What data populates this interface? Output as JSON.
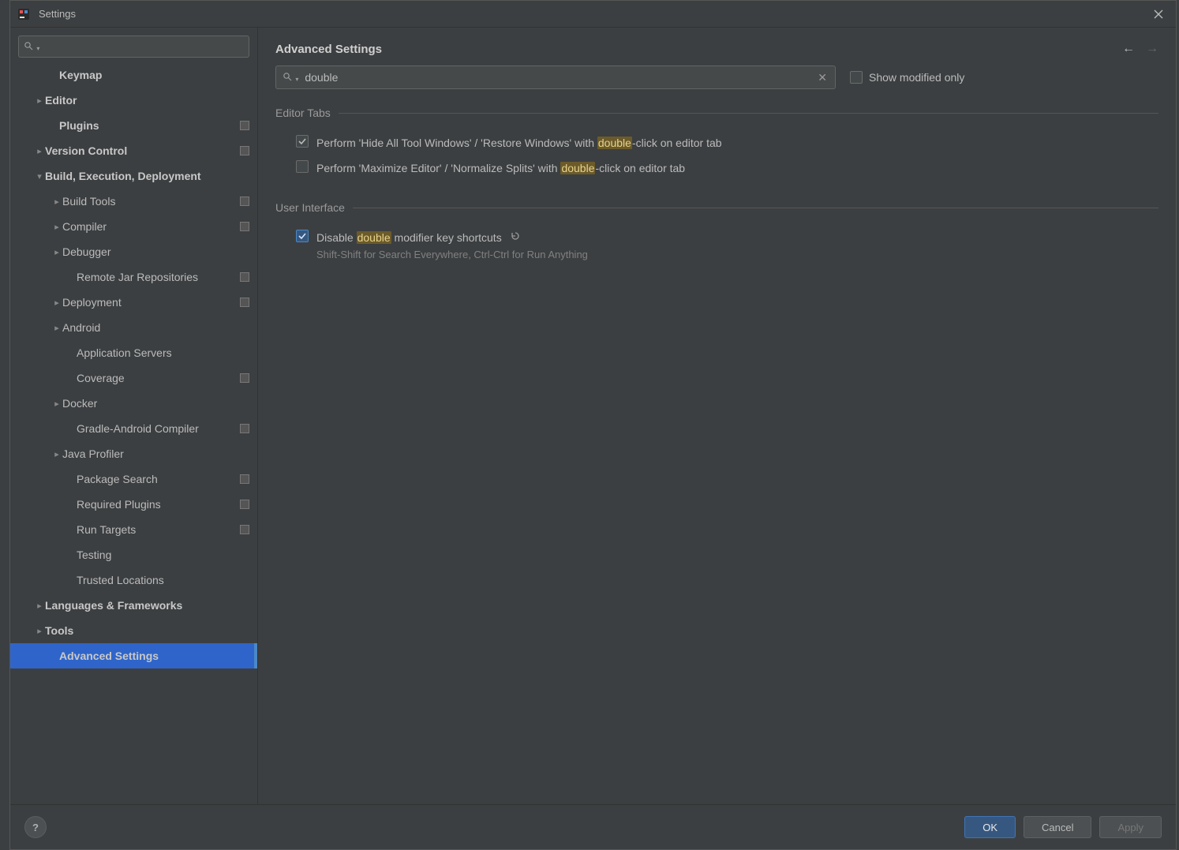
{
  "window": {
    "title": "Settings"
  },
  "sidebar": {
    "search_placeholder": "",
    "items": [
      {
        "label": "Keymap",
        "indent": 48,
        "bold": true,
        "chev": ""
      },
      {
        "label": "Editor",
        "indent": 30,
        "bold": true,
        "chev": "right"
      },
      {
        "label": "Plugins",
        "indent": 48,
        "bold": true,
        "chev": "",
        "marker": true
      },
      {
        "label": "Version Control",
        "indent": 30,
        "bold": true,
        "chev": "right",
        "marker": true
      },
      {
        "label": "Build, Execution, Deployment",
        "indent": 30,
        "bold": true,
        "chev": "down"
      },
      {
        "label": "Build Tools",
        "indent": 52,
        "bold": false,
        "chev": "right",
        "marker": true
      },
      {
        "label": "Compiler",
        "indent": 52,
        "bold": false,
        "chev": "right",
        "marker": true
      },
      {
        "label": "Debugger",
        "indent": 52,
        "bold": false,
        "chev": "right"
      },
      {
        "label": "Remote Jar Repositories",
        "indent": 70,
        "bold": false,
        "chev": "",
        "marker": true
      },
      {
        "label": "Deployment",
        "indent": 52,
        "bold": false,
        "chev": "right",
        "marker": true
      },
      {
        "label": "Android",
        "indent": 52,
        "bold": false,
        "chev": "right"
      },
      {
        "label": "Application Servers",
        "indent": 70,
        "bold": false,
        "chev": ""
      },
      {
        "label": "Coverage",
        "indent": 70,
        "bold": false,
        "chev": "",
        "marker": true
      },
      {
        "label": "Docker",
        "indent": 52,
        "bold": false,
        "chev": "right"
      },
      {
        "label": "Gradle-Android Compiler",
        "indent": 70,
        "bold": false,
        "chev": "",
        "marker": true
      },
      {
        "label": "Java Profiler",
        "indent": 52,
        "bold": false,
        "chev": "right"
      },
      {
        "label": "Package Search",
        "indent": 70,
        "bold": false,
        "chev": "",
        "marker": true
      },
      {
        "label": "Required Plugins",
        "indent": 70,
        "bold": false,
        "chev": "",
        "marker": true
      },
      {
        "label": "Run Targets",
        "indent": 70,
        "bold": false,
        "chev": "",
        "marker": true
      },
      {
        "label": "Testing",
        "indent": 70,
        "bold": false,
        "chev": ""
      },
      {
        "label": "Trusted Locations",
        "indent": 70,
        "bold": false,
        "chev": ""
      },
      {
        "label": "Languages & Frameworks",
        "indent": 30,
        "bold": true,
        "chev": "right"
      },
      {
        "label": "Tools",
        "indent": 30,
        "bold": true,
        "chev": "right"
      },
      {
        "label": "Advanced Settings",
        "indent": 48,
        "bold": true,
        "chev": "",
        "selected": true
      }
    ]
  },
  "main": {
    "title": "Advanced Settings",
    "filter_value": "double",
    "show_modified_label": "Show modified only",
    "show_modified_checked": false,
    "sections": {
      "editor_tabs": {
        "title": "Editor Tabs",
        "opt1": {
          "checked": true,
          "pre": "Perform 'Hide All Tool Windows' / 'Restore Windows' with ",
          "hl": "double",
          "post": "-click on editor tab"
        },
        "opt2": {
          "checked": false,
          "pre": "Perform 'Maximize Editor' / 'Normalize Splits' with ",
          "hl": "double",
          "post": "-click on editor tab"
        }
      },
      "ui": {
        "title": "User Interface",
        "opt1": {
          "checked": true,
          "blue": true,
          "pre": "Disable ",
          "hl": "double",
          "post": " modifier key shortcuts",
          "revert": true,
          "hint": "Shift-Shift for Search Everywhere, Ctrl-Ctrl for Run Anything"
        }
      }
    }
  },
  "footer": {
    "ok": "OK",
    "cancel": "Cancel",
    "apply": "Apply"
  }
}
